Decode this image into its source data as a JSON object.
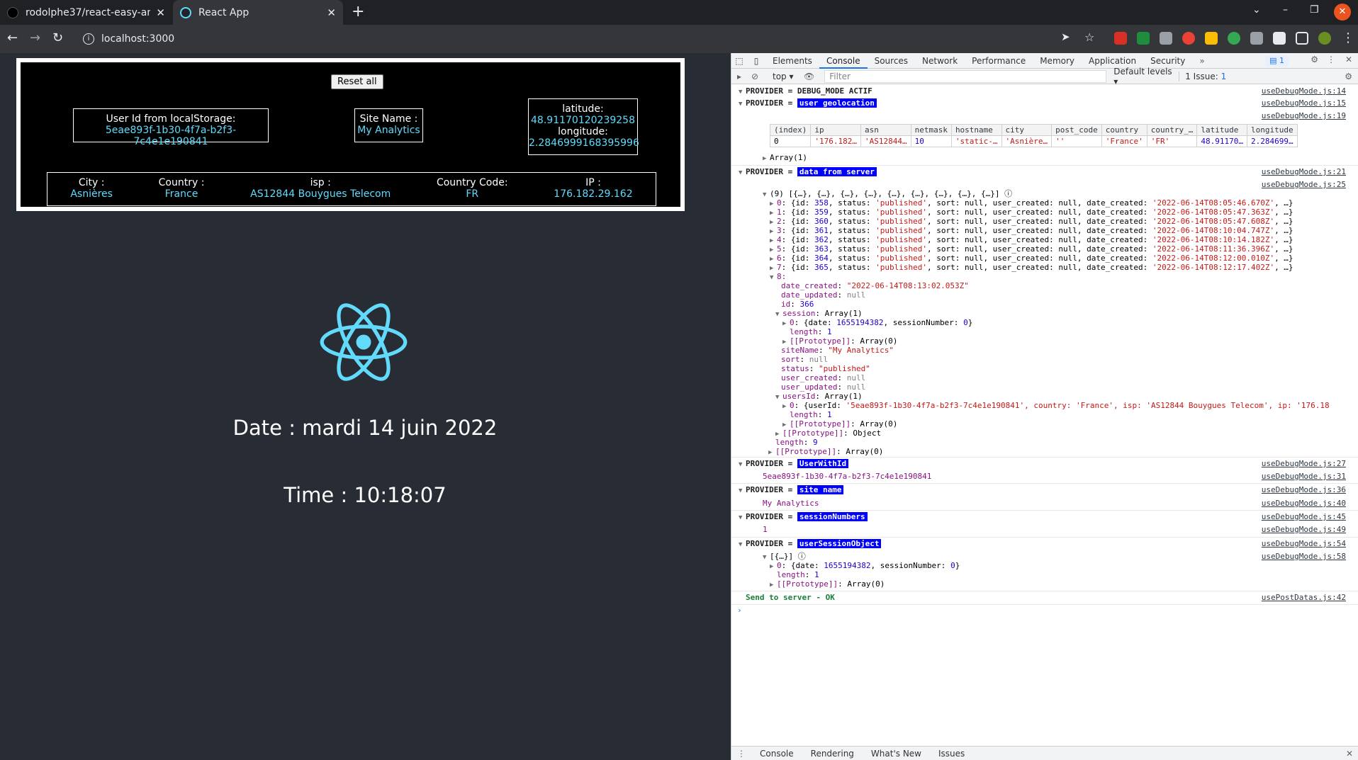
{
  "browser": {
    "tabs": [
      {
        "title": "rodolphe37/react-easy-an",
        "active": false
      },
      {
        "title": "React App",
        "active": true
      }
    ],
    "url": "localhost:3000"
  },
  "app": {
    "reset_label": "Reset all",
    "user_id_label": "User Id from localStorage:",
    "user_id_value": "5eae893f-1b30-4f7a-b2f3-7c4e1e190841",
    "site_name_label": "Site Name :",
    "site_name_value": "My Analytics",
    "latitude_label": "latitude:",
    "latitude_value": "48.91170120239258",
    "longitude_label": "longitude:",
    "longitude_value": "2.2846999168395996",
    "city_label": "City :",
    "city_value": "Asnières",
    "country_label": "Country :",
    "country_value": "France",
    "isp_label": "isp :",
    "isp_value": "AS12844 Bouygues Telecom",
    "country_code_label": "Country Code:",
    "country_code_value": "FR",
    "ip_label": "IP :",
    "ip_value": "176.182.29.162",
    "date_text": "Date : mardi 14 juin 2022",
    "time_text": "Time : 10:18:07",
    "accent_color": "#61dafb"
  },
  "devtools": {
    "tabs": [
      "Elements",
      "Console",
      "Sources",
      "Network",
      "Performance",
      "Memory",
      "Application",
      "Security"
    ],
    "active_tab": "Console",
    "issues_badge": "1",
    "context": "top",
    "filter_placeholder": "Filter",
    "levels": "Default levels",
    "issues_label": "1 Issue:",
    "issues_count": "1",
    "drawer_tabs": [
      "Console",
      "Rendering",
      "What's New",
      "Issues"
    ],
    "console": {
      "header": "PROVIDER = DEBUG_MODE ACTIF",
      "header_src": "useDebugMode.js:14",
      "geo_label": "user geolocation",
      "geo_src": "useDebugMode.js:15",
      "geo_src2": "useDebugMode.js:19",
      "geo_table_headers": [
        "(index)",
        "ip",
        "asn",
        "netmask",
        "hostname",
        "city",
        "post_code",
        "country",
        "country_…",
        "latitude",
        "longitude"
      ],
      "geo_table_row": [
        "0",
        "'176.182…",
        "'AS12844…",
        "10",
        "'static-…",
        "'Asnière…",
        "''",
        "'France'",
        "'FR'",
        "48.91170…",
        "2.284699…"
      ],
      "geo_array": "Array(1)",
      "server_label": "data from server",
      "server_src": "useDebugMode.js:21",
      "server_src2": "useDebugMode.js:25",
      "server_summary": "(9) [{…}, {…}, {…}, {…}, {…}, {…}, {…}, {…}, {…}]",
      "records": [
        {
          "i": "0",
          "id": "358",
          "date": "'2022-06-14T08:05:46.670Z'"
        },
        {
          "i": "1",
          "id": "359",
          "date": "'2022-06-14T08:05:47.363Z'"
        },
        {
          "i": "2",
          "id": "360",
          "date": "'2022-06-14T08:05:47.608Z'"
        },
        {
          "i": "3",
          "id": "361",
          "date": "'2022-06-14T08:10:04.747Z'"
        },
        {
          "i": "4",
          "id": "362",
          "date": "'2022-06-14T08:10:14.182Z'"
        },
        {
          "i": "5",
          "id": "363",
          "date": "'2022-06-14T08:11:36.396Z'"
        },
        {
          "i": "6",
          "id": "364",
          "date": "'2022-06-14T08:12:00.010Z'"
        },
        {
          "i": "7",
          "id": "365",
          "date": "'2022-06-14T08:12:17.402Z'"
        }
      ],
      "record8": {
        "date_created": "\"2022-06-14T08:13:02.053Z\"",
        "id": "366",
        "session_date": "1655194382",
        "session_number": "0",
        "siteName": "\"My Analytics\"",
        "status": "\"published\"",
        "usersId_line": "'5eae893f-1b30-4f7a-b2f3-7c4e1e190841', country: 'France', isp: 'AS12844 Bouygues Telecom', ip: '176.18"
      },
      "userwithid_label": "UserWithId",
      "userwithid_src": "useDebugMode.js:27",
      "userwithid_value": "5eae893f-1b30-4f7a-b2f3-7c4e1e190841",
      "userwithid_src2": "useDebugMode.js:31",
      "sitename_label": "site name",
      "sitename_src": "useDebugMode.js:36",
      "sitename_value": "My Analytics",
      "sitename_src2": "useDebugMode.js:40",
      "sessionnumbers_label": "sessionNumbers",
      "sessionnumbers_src": "useDebugMode.js:45",
      "sessionnumbers_value": "1",
      "sessionnumbers_src2": "useDebugMode.js:49",
      "usersession_label": "userSessionObject",
      "usersession_src": "useDebugMode.js:54",
      "usersession_src2": "useDebugMode.js:58",
      "send_ok": "Send to server - OK",
      "send_src": "usePostDatas.js:42"
    }
  }
}
